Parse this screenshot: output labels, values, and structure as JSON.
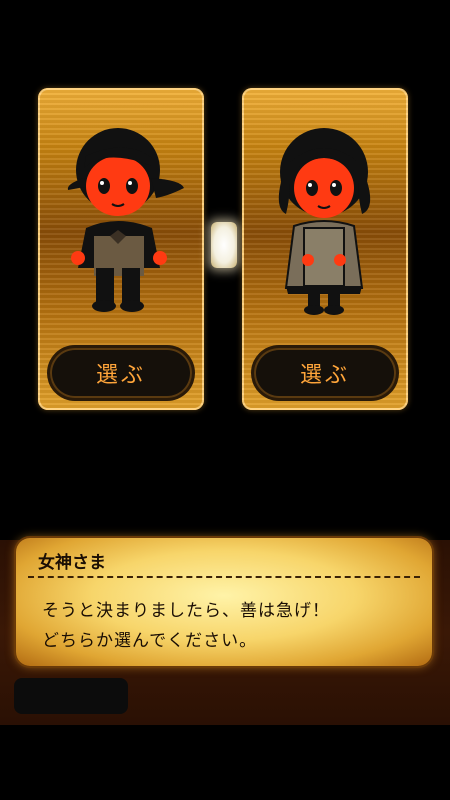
{
  "cards": [
    {
      "character": "left-character",
      "choose_label": "選ぶ"
    },
    {
      "character": "right-character",
      "choose_label": "選ぶ"
    }
  ],
  "dialog": {
    "speaker": "女神さま",
    "line1": "そうと決まりましたら、善は急げ！",
    "line2": "どちらか選んでください。"
  },
  "colors": {
    "card_gold": "#c98512",
    "button_text": "#ffa53a",
    "dialog_glow": "#f7d56a",
    "character_face": "#ff3a1a"
  }
}
